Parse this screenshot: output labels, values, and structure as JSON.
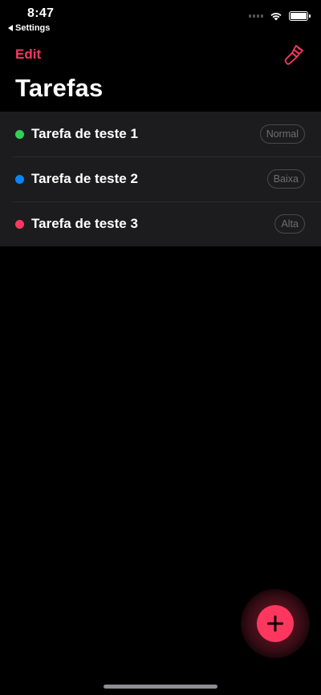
{
  "status_bar": {
    "time": "8:47",
    "back_label": "Settings"
  },
  "nav": {
    "edit_label": "Edit",
    "brush_icon": "paintbrush-icon"
  },
  "title": "Tarefas",
  "tasks": [
    {
      "title": "Tarefa de teste 1",
      "priority": "Normal",
      "color": "#30d158"
    },
    {
      "title": "Tarefa de teste 2",
      "priority": "Baixa",
      "color": "#0a84ff"
    },
    {
      "title": "Tarefa de teste 3",
      "priority": "Alta",
      "color": "#ff375f"
    }
  ],
  "fab": {
    "icon": "plus-icon",
    "color": "#ff375f"
  },
  "colors": {
    "accent": "#ff375f",
    "background": "#000000",
    "row_background": "#1c1c1e"
  }
}
